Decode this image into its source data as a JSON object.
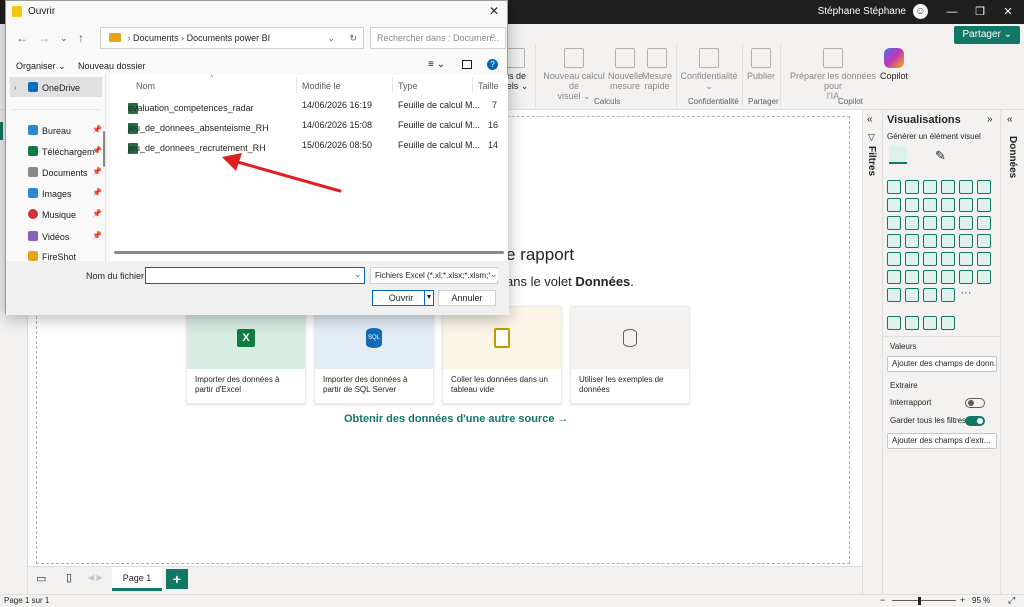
{
  "titlebar": {
    "user_name": "Stéphane Stéphane"
  },
  "ribbon": {
    "share_label": "Partager ⌄",
    "items": [
      {
        "label": "us de\nuels ⌄"
      },
      {
        "label": "Nouveau calcul de\nvisuel ⌄"
      },
      {
        "label": "Nouvelle\nmesure"
      },
      {
        "label": "Mesure\nrapide"
      },
      {
        "label": "Confidentialité\n⌄"
      },
      {
        "label": "Publier"
      },
      {
        "label": "Préparer les données pour\nl'IA"
      },
      {
        "label": "Copilot"
      }
    ],
    "groups": {
      "calculs": "Calculs",
      "confidentialite": "Confidentialité",
      "partager": "Partager",
      "copilot": "Copilot"
    }
  },
  "canvas": {
    "title_fragment": "e rapport",
    "subtitle_prefix": "ans le volet ",
    "subtitle_bold": "Données",
    "subtitle_suffix": ".",
    "cards": [
      {
        "label": "Importer des données à partir d'Excel",
        "icon": "excel-icon",
        "color": "#d7ede2"
      },
      {
        "label": "Importer des données à partir de SQL Server",
        "icon": "sql-icon",
        "color": "#e4ecf6"
      },
      {
        "label": "Coller les données dans un tableau vide",
        "icon": "paste-icon",
        "color": "#fbf5e6"
      },
      {
        "label": "Utiliser les exemples de données",
        "icon": "database-icon",
        "color": "#f3f2f1"
      }
    ],
    "other_source": "Obtenir des données d'une autre source →"
  },
  "pagebar": {
    "page_tab": "Page 1",
    "add_label": "+"
  },
  "statusbar": {
    "page_info": "Page 1 sur 1",
    "zoom": "95 %"
  },
  "filters_pane": {
    "label": "Filtres"
  },
  "viz_pane": {
    "title": "Visualisations",
    "subtitle": "Générer un élément visuel",
    "values_label": "Valeurs",
    "values_field": "Ajouter des champs de donn...",
    "extract_label": "Extraire",
    "cross_report": "Interrapport",
    "keep_filters": "Garder tous les filtres",
    "extract_field": "Ajouter des champs d'extr..."
  },
  "data_pane": {
    "label": "Données"
  },
  "dialog": {
    "title": "Ouvrir",
    "breadcrumb": [
      "Documents",
      "Documents power BI"
    ],
    "search_placeholder": "Rechercher dans : Documen...",
    "organize": "Organiser ⌄",
    "new_folder": "Nouveau dossier",
    "sidebar": [
      {
        "label": "OneDrive",
        "icon": "cloud-icon",
        "color": "#0f6cbd"
      },
      {
        "label": "Bureau",
        "icon": "desktop-icon",
        "color": "#2b88d8"
      },
      {
        "label": "Téléchargem",
        "icon": "download-icon",
        "color": "#107c41"
      },
      {
        "label": "Documents",
        "icon": "document-icon",
        "color": "#8a8886"
      },
      {
        "label": "Images",
        "icon": "image-icon",
        "color": "#2b88d8"
      },
      {
        "label": "Musique",
        "icon": "music-icon",
        "color": "#d13438"
      },
      {
        "label": "Vidéos",
        "icon": "video-icon",
        "color": "#8764b8"
      },
      {
        "label": "FireShot",
        "icon": "folder-icon",
        "color": "#e8a317"
      }
    ],
    "columns": {
      "name": "Nom",
      "modified": "Modifié le",
      "type": "Type",
      "size": "Taille"
    },
    "files": [
      {
        "name": "evaluation_competences_radar",
        "modified": "14/06/2026 16:19",
        "type": "Feuille de calcul M...",
        "size": "7"
      },
      {
        "name": "jeu_de_donnees_absenteisme_RH",
        "modified": "14/06/2026 15:08",
        "type": "Feuille de calcul M...",
        "size": "16"
      },
      {
        "name": "jeu_de_donnees_recrutement_RH",
        "modified": "15/06/2026 08:50",
        "type": "Feuille de calcul M...",
        "size": "14"
      }
    ],
    "filename_label": "Nom du fichier :",
    "filename_value": "",
    "filetype": "Fichiers Excel (*.xl;*.xlsx;*.xlsm;*.",
    "open_label": "Ouvrir",
    "cancel_label": "Annuler"
  }
}
